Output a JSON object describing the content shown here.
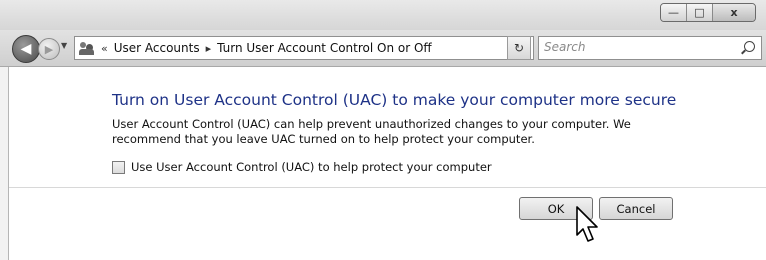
{
  "window": {
    "caption_buttons": {
      "minimize": "—",
      "maximize": "□",
      "close": "x"
    }
  },
  "navigation": {
    "back_glyph": "◀",
    "forward_glyph": "▶",
    "recent_dropdown_glyph": "▼",
    "breadcrumb_separator_start": "«",
    "breadcrumb_separator": "▸",
    "breadcrumbs": [
      "User Accounts",
      "Turn User Account Control On or Off"
    ],
    "address_dropdown_glyph": "▼",
    "refresh_glyph": "↻",
    "search_placeholder": "Search"
  },
  "content": {
    "heading": "Turn on User Account Control (UAC) to make your computer more secure",
    "description": "User Account Control (UAC) can help prevent unauthorized changes to your computer.  We recommend that you leave UAC turned on to help protect your computer.",
    "checkbox_label": "Use User Account Control (UAC) to help protect your computer",
    "checkbox_checked": false
  },
  "buttons": {
    "ok": "OK",
    "cancel": "Cancel"
  },
  "icons": {
    "users": "users-icon",
    "search": "search-icon",
    "cursor": "mouse-pointer-icon"
  },
  "colors": {
    "heading": "#1e3287"
  }
}
